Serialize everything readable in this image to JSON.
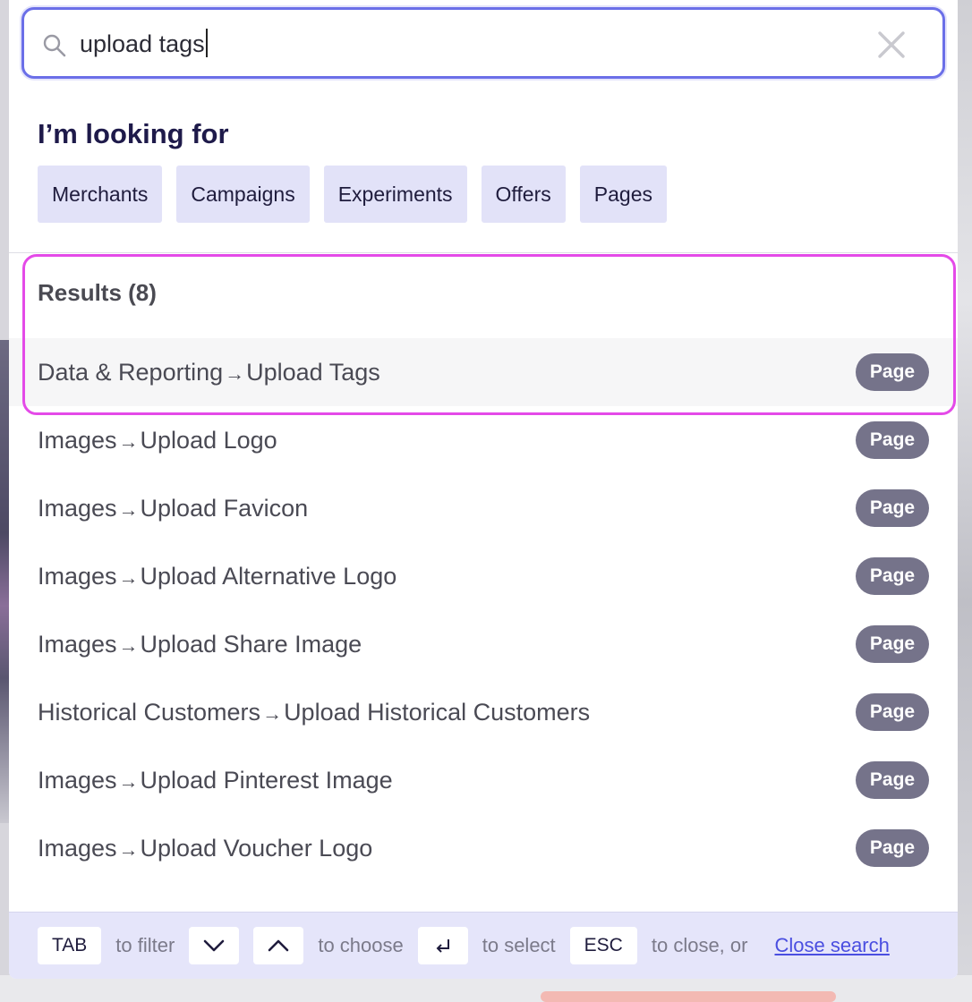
{
  "search": {
    "value": "upload tags",
    "placeholder": ""
  },
  "looking_for": {
    "title": "I’m looking for",
    "filters": [
      "Merchants",
      "Campaigns",
      "Experiments",
      "Offers",
      "Pages"
    ]
  },
  "results": {
    "title": "Results (8)",
    "items": [
      {
        "section": "Data & Reporting",
        "page": "Upload Tags",
        "badge": "Page"
      },
      {
        "section": "Images",
        "page": "Upload Logo",
        "badge": "Page"
      },
      {
        "section": "Images",
        "page": "Upload Favicon",
        "badge": "Page"
      },
      {
        "section": "Images",
        "page": "Upload Alternative Logo",
        "badge": "Page"
      },
      {
        "section": "Images",
        "page": "Upload Share Image",
        "badge": "Page"
      },
      {
        "section": "Historical Customers",
        "page": "Upload Historical Customers",
        "badge": "Page"
      },
      {
        "section": "Images",
        "page": "Upload Pinterest Image",
        "badge": "Page"
      },
      {
        "section": "Images",
        "page": "Upload Voucher Logo",
        "badge": "Page"
      }
    ]
  },
  "footer": {
    "tab_key": "TAB",
    "tab_text": "to filter",
    "choose_text": "to choose",
    "select_text": "to select",
    "esc_key": "ESC",
    "esc_text": "to close, or",
    "close_link": "Close search"
  },
  "colors": {
    "accent": "#6b6fe8",
    "highlight": "#e44ae8",
    "badge": "#75738a",
    "chip": "#e2e2f8",
    "footer_bg": "#e5e5fa"
  },
  "icons": {
    "search": "search-icon",
    "clear": "close-icon",
    "arrow": "arrow-right-icon",
    "down": "chevron-down-icon",
    "up": "chevron-up-icon",
    "enter": "enter-icon"
  }
}
